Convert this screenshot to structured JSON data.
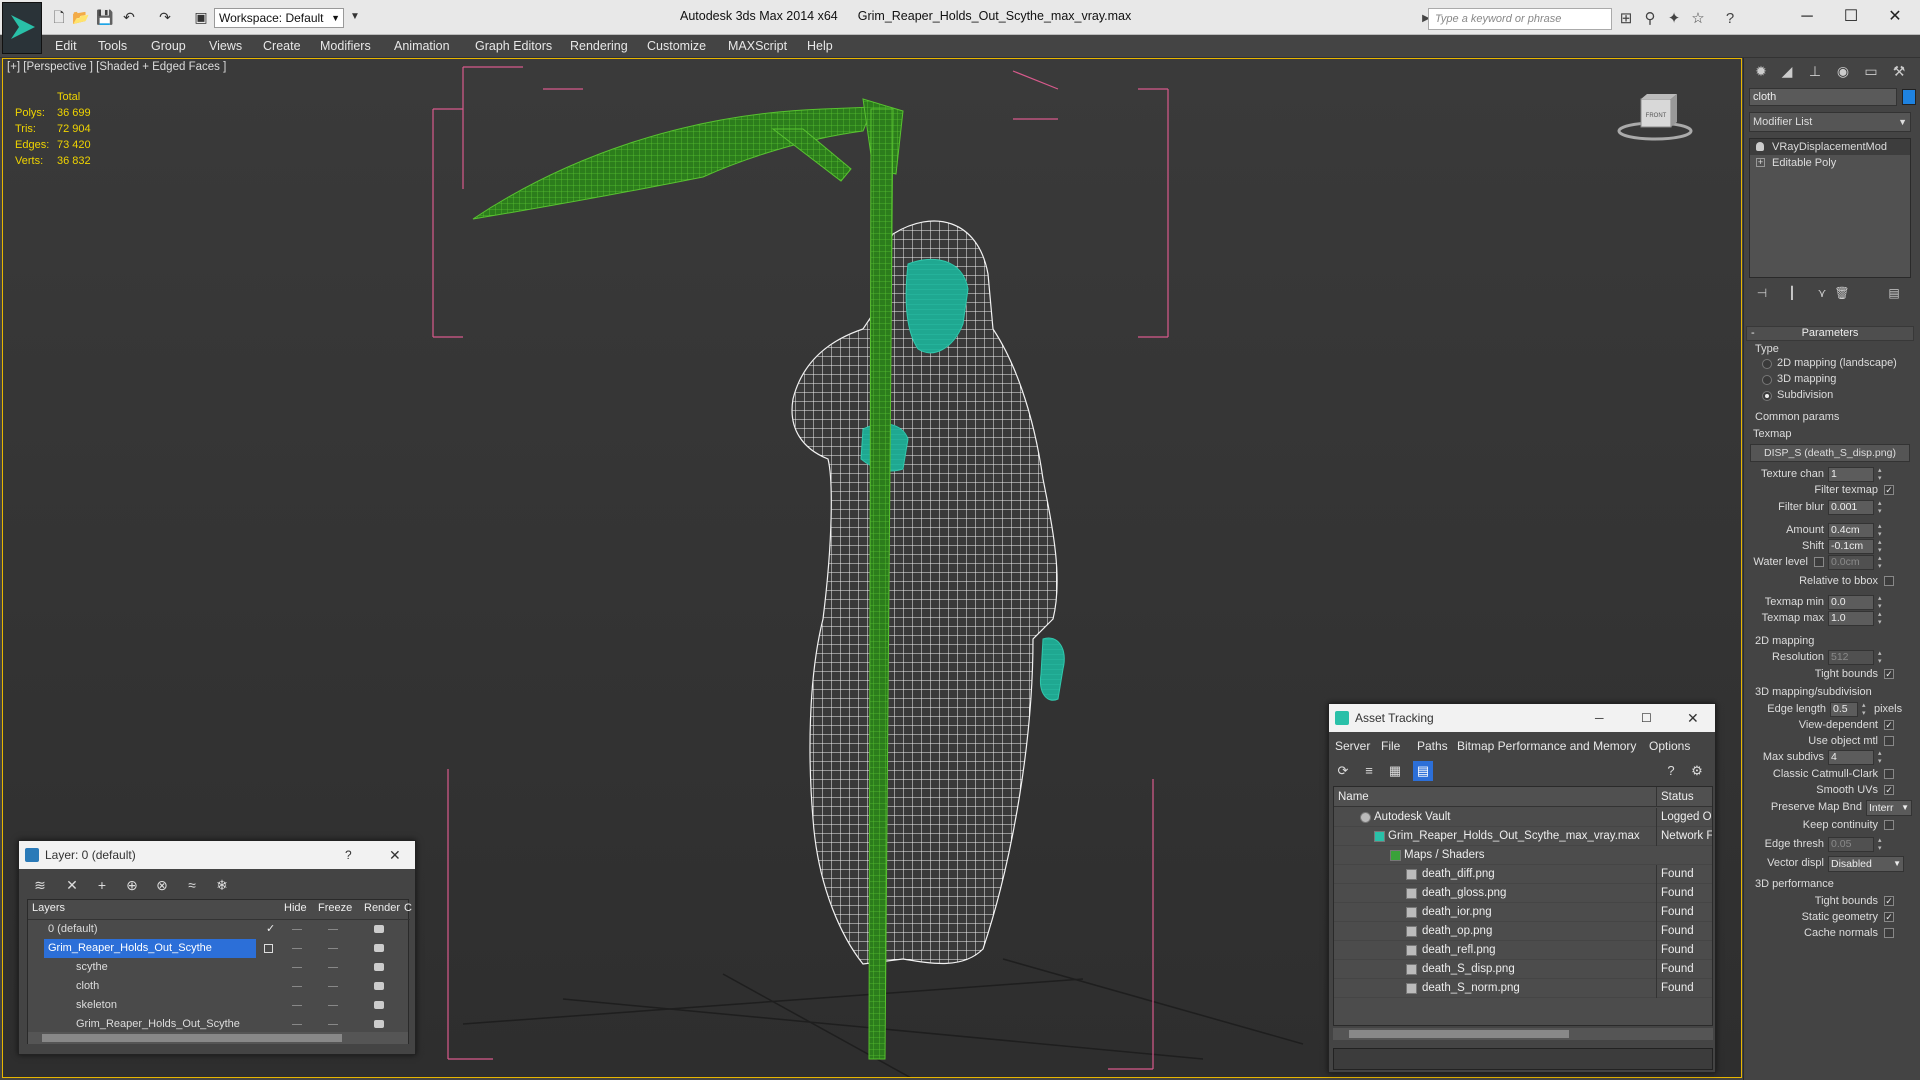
{
  "app": {
    "title": "Autodesk 3ds Max  2014 x64",
    "file": "Grim_Reaper_Holds_Out_Scythe_max_vray.max",
    "workspace": "Workspace: Default",
    "search_placeholder": "Type a keyword or phrase"
  },
  "menu": [
    "Edit",
    "Tools",
    "Group",
    "Views",
    "Create",
    "Modifiers",
    "Animation",
    "Graph Editors",
    "Rendering",
    "Customize",
    "MAXScript",
    "Help"
  ],
  "viewport": {
    "label": "[+] [Perspective ] [Shaded + Edged Faces ]",
    "stats_header": "Total",
    "stats": [
      {
        "label": "Polys:",
        "value": "36 699"
      },
      {
        "label": "Tris:",
        "value": "72 904"
      },
      {
        "label": "Edges:",
        "value": "73 420"
      },
      {
        "label": "Verts:",
        "value": "36 832"
      }
    ],
    "viewcube_face": "FRONT"
  },
  "command_panel": {
    "object_name": "cloth",
    "object_color": "#1e82e0",
    "modifier_list": "Modifier List",
    "stack": [
      "VRayDisplacementMod",
      "Editable Poly"
    ],
    "parameters_title": "Parameters",
    "type_label": "Type",
    "type_options": [
      {
        "label": "2D mapping (landscape)",
        "selected": false
      },
      {
        "label": "3D mapping",
        "selected": false
      },
      {
        "label": "Subdivision",
        "selected": true
      }
    ],
    "common_params": "Common params",
    "texmap_label": "Texmap",
    "texmap_button": "DISP_S (death_S_disp.png)",
    "texture_chan_label": "Texture chan",
    "texture_chan": "1",
    "filter_texmap_label": "Filter texmap",
    "filter_blur_label": "Filter blur",
    "filter_blur": "0.001",
    "amount_label": "Amount",
    "amount": "0.4cm",
    "shift_label": "Shift",
    "shift": "-0.1cm",
    "water_level_label": "Water level",
    "water_level": "0.0cm",
    "relative_bbox_label": "Relative to bbox",
    "texmap_min_label": "Texmap min",
    "texmap_min": "0.0",
    "texmap_max_label": "Texmap max",
    "texmap_max": "1.0",
    "mapping2d_title": "2D mapping",
    "resolution_label": "Resolution",
    "resolution": "512",
    "tight_bounds_label": "Tight bounds",
    "subdiv_title": "3D mapping/subdivision",
    "edge_length_label": "Edge length",
    "edge_length": "0.5",
    "pixels_label": "pixels",
    "view_dependent_label": "View-dependent",
    "use_object_mtl_label": "Use object mtl",
    "max_subdivs_label": "Max subdivs",
    "max_subdivs": "4",
    "classic_cc_label": "Classic Catmull-Clark",
    "smooth_uvs_label": "Smooth UVs",
    "preserve_map_label": "Preserve Map Bnd",
    "preserve_map_value": "Interr",
    "keep_continuity_label": "Keep continuity",
    "edge_thresh_label": "Edge thresh",
    "edge_thresh": "0.05",
    "vector_displ_label": "Vector displ",
    "vector_displ_value": "Disabled",
    "perf_title": "3D performance",
    "perf_tight_bounds_label": "Tight bounds",
    "static_geometry_label": "Static geometry",
    "cache_normals_label": "Cache normals"
  },
  "layer_window": {
    "title": "Layer: 0 (default)",
    "help": "?",
    "columns": [
      "Layers",
      "Hide",
      "Freeze",
      "Render",
      "C"
    ],
    "rows": [
      {
        "name": "0 (default)",
        "indent": 1,
        "selected": false
      },
      {
        "name": "Grim_Reaper_Holds_Out_Scythe",
        "indent": 1,
        "selected": true
      },
      {
        "name": "scythe",
        "indent": 2,
        "selected": false
      },
      {
        "name": "cloth",
        "indent": 2,
        "selected": false
      },
      {
        "name": "skeleton",
        "indent": 2,
        "selected": false
      },
      {
        "name": "Grim_Reaper_Holds_Out_Scythe",
        "indent": 2,
        "selected": false
      }
    ]
  },
  "asset_window": {
    "title": "Asset Tracking",
    "menu": [
      "Server",
      "File",
      "Paths",
      "Bitmap Performance and Memory",
      "Options"
    ],
    "columns": [
      "Name",
      "Status"
    ],
    "rows": [
      {
        "name": "Autodesk Vault",
        "status": "Logged O",
        "indent": 1
      },
      {
        "name": "Grim_Reaper_Holds_Out_Scythe_max_vray.max",
        "status": "Network F",
        "indent": 2
      },
      {
        "name": "Maps / Shaders",
        "status": "",
        "indent": 3
      },
      {
        "name": "death_diff.png",
        "status": "Found",
        "indent": 4
      },
      {
        "name": "death_gloss.png",
        "status": "Found",
        "indent": 4
      },
      {
        "name": "death_ior.png",
        "status": "Found",
        "indent": 4
      },
      {
        "name": "death_op.png",
        "status": "Found",
        "indent": 4
      },
      {
        "name": "death_refl.png",
        "status": "Found",
        "indent": 4
      },
      {
        "name": "death_S_disp.png",
        "status": "Found",
        "indent": 4
      },
      {
        "name": "death_S_norm.png",
        "status": "Found",
        "indent": 4
      }
    ]
  }
}
